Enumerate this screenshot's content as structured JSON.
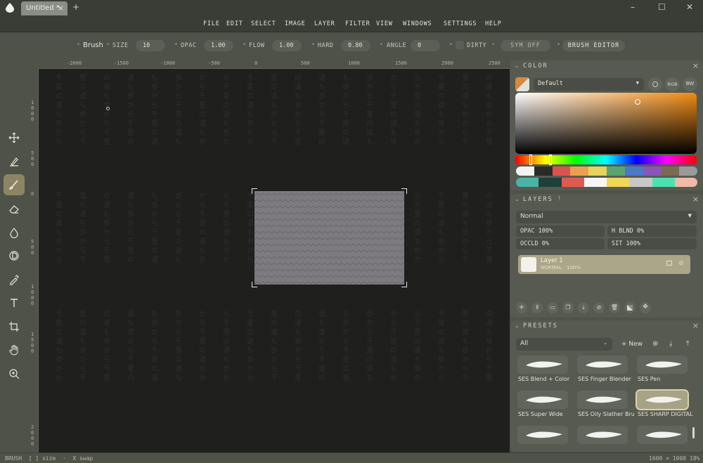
{
  "window": {
    "tab_title": "Untitled *",
    "tab_close": "×",
    "tab_add": "+",
    "minimize": "–",
    "maximize": "☐",
    "close": "✕"
  },
  "menu": [
    "FILE",
    "EDIT",
    "SELECT",
    "IMAGE",
    "LAYER",
    "FILTER",
    "VIEW",
    "WINDOWS",
    "SETTINGS",
    "HELP"
  ],
  "toolbar": {
    "tool_name": "Brush",
    "size_label": "SIZE",
    "size_value": "10",
    "opac_label": "OPAC",
    "opac_value": "1.00",
    "flow_label": "FLOW",
    "flow_value": "1.00",
    "hard_label": "HARD",
    "hard_value": "0.80",
    "angle_label": "ANGLE",
    "angle_value": "0",
    "dirty_label": "DIRTY",
    "sym_label": "SYM OFF",
    "brush_editor_label": "BRUSH EDITOR"
  },
  "ruler": {
    "top_ticks": [
      "-2000",
      "-1500",
      "-1000",
      "-500",
      "0",
      "500",
      "1000",
      "1500",
      "2000",
      "2500"
    ],
    "left_ticks": [
      "1000",
      "500",
      "0",
      "500",
      "1000",
      "1500",
      "2000"
    ]
  },
  "tools": [
    {
      "name": "move-tool",
      "icon": "move-icon"
    },
    {
      "name": "smudge-tool",
      "icon": "smudge-icon"
    },
    {
      "name": "brush-tool",
      "icon": "brush-icon",
      "active": true
    },
    {
      "name": "eraser-tool",
      "icon": "eraser-icon"
    },
    {
      "name": "fill-tool",
      "icon": "drop-icon"
    },
    {
      "name": "dodge-tool",
      "icon": "dodge-icon"
    },
    {
      "name": "eyedropper-tool",
      "icon": "eyedropper-icon"
    },
    {
      "name": "text-tool",
      "icon": "text-icon"
    },
    {
      "name": "crop-tool",
      "icon": "crop-icon"
    },
    {
      "name": "hand-tool",
      "icon": "hand-icon"
    },
    {
      "name": "zoom-tool",
      "icon": "zoom-icon"
    }
  ],
  "colors": {
    "accent": "#8c8564",
    "canvas_bg": "#1f1f1d",
    "document_fill": "#7d7b7f"
  },
  "color_panel": {
    "title": "COLOR",
    "palette_name": "Default",
    "rgb_label": "RGB",
    "bw_label": "BW",
    "swatches_row1": [
      "#f2f2ee",
      "#2a2a28",
      "#d9544f",
      "#e8a24f",
      "#e6d35a",
      "#5aa56f",
      "#4a79c8",
      "#8a55b8",
      "#7a6a54",
      "#9a9a9a"
    ],
    "swatches_row2": [
      "#4ab3a6",
      "#1f3f3a",
      "#e05a52",
      "#f6f6f2",
      "#efd75a",
      "#c8c8c8",
      "#4fe0b0",
      "#f2b8a8"
    ]
  },
  "layers_panel": {
    "title": "LAYERS",
    "blend_mode": "Normal",
    "opac": "OPAC 100%",
    "h_blnd": "H BLND 0%",
    "occld": "OCCLD 0%",
    "sit": "SIT 100%",
    "layers": [
      {
        "name": "Layer 1",
        "meta": "NORMAL · 100%"
      }
    ]
  },
  "presets_panel": {
    "title": "PRESETS",
    "filter": "All",
    "new_label": "+ New",
    "presets": [
      {
        "label": "SES Blend + Color"
      },
      {
        "label": "SES Finger Blender"
      },
      {
        "label": "SES Pen"
      },
      {
        "label": "SES Super Wide"
      },
      {
        "label": "SES Oily Slather Brush"
      },
      {
        "label": "SES SHARP DIGITAL",
        "selected": true
      },
      {
        "label": ""
      },
      {
        "label": ""
      },
      {
        "label": ""
      }
    ]
  },
  "status": {
    "left": "BRUSH  [ ] size  ·  X swap",
    "dimensions": "1600 × 1000",
    "zoom": "18%"
  }
}
